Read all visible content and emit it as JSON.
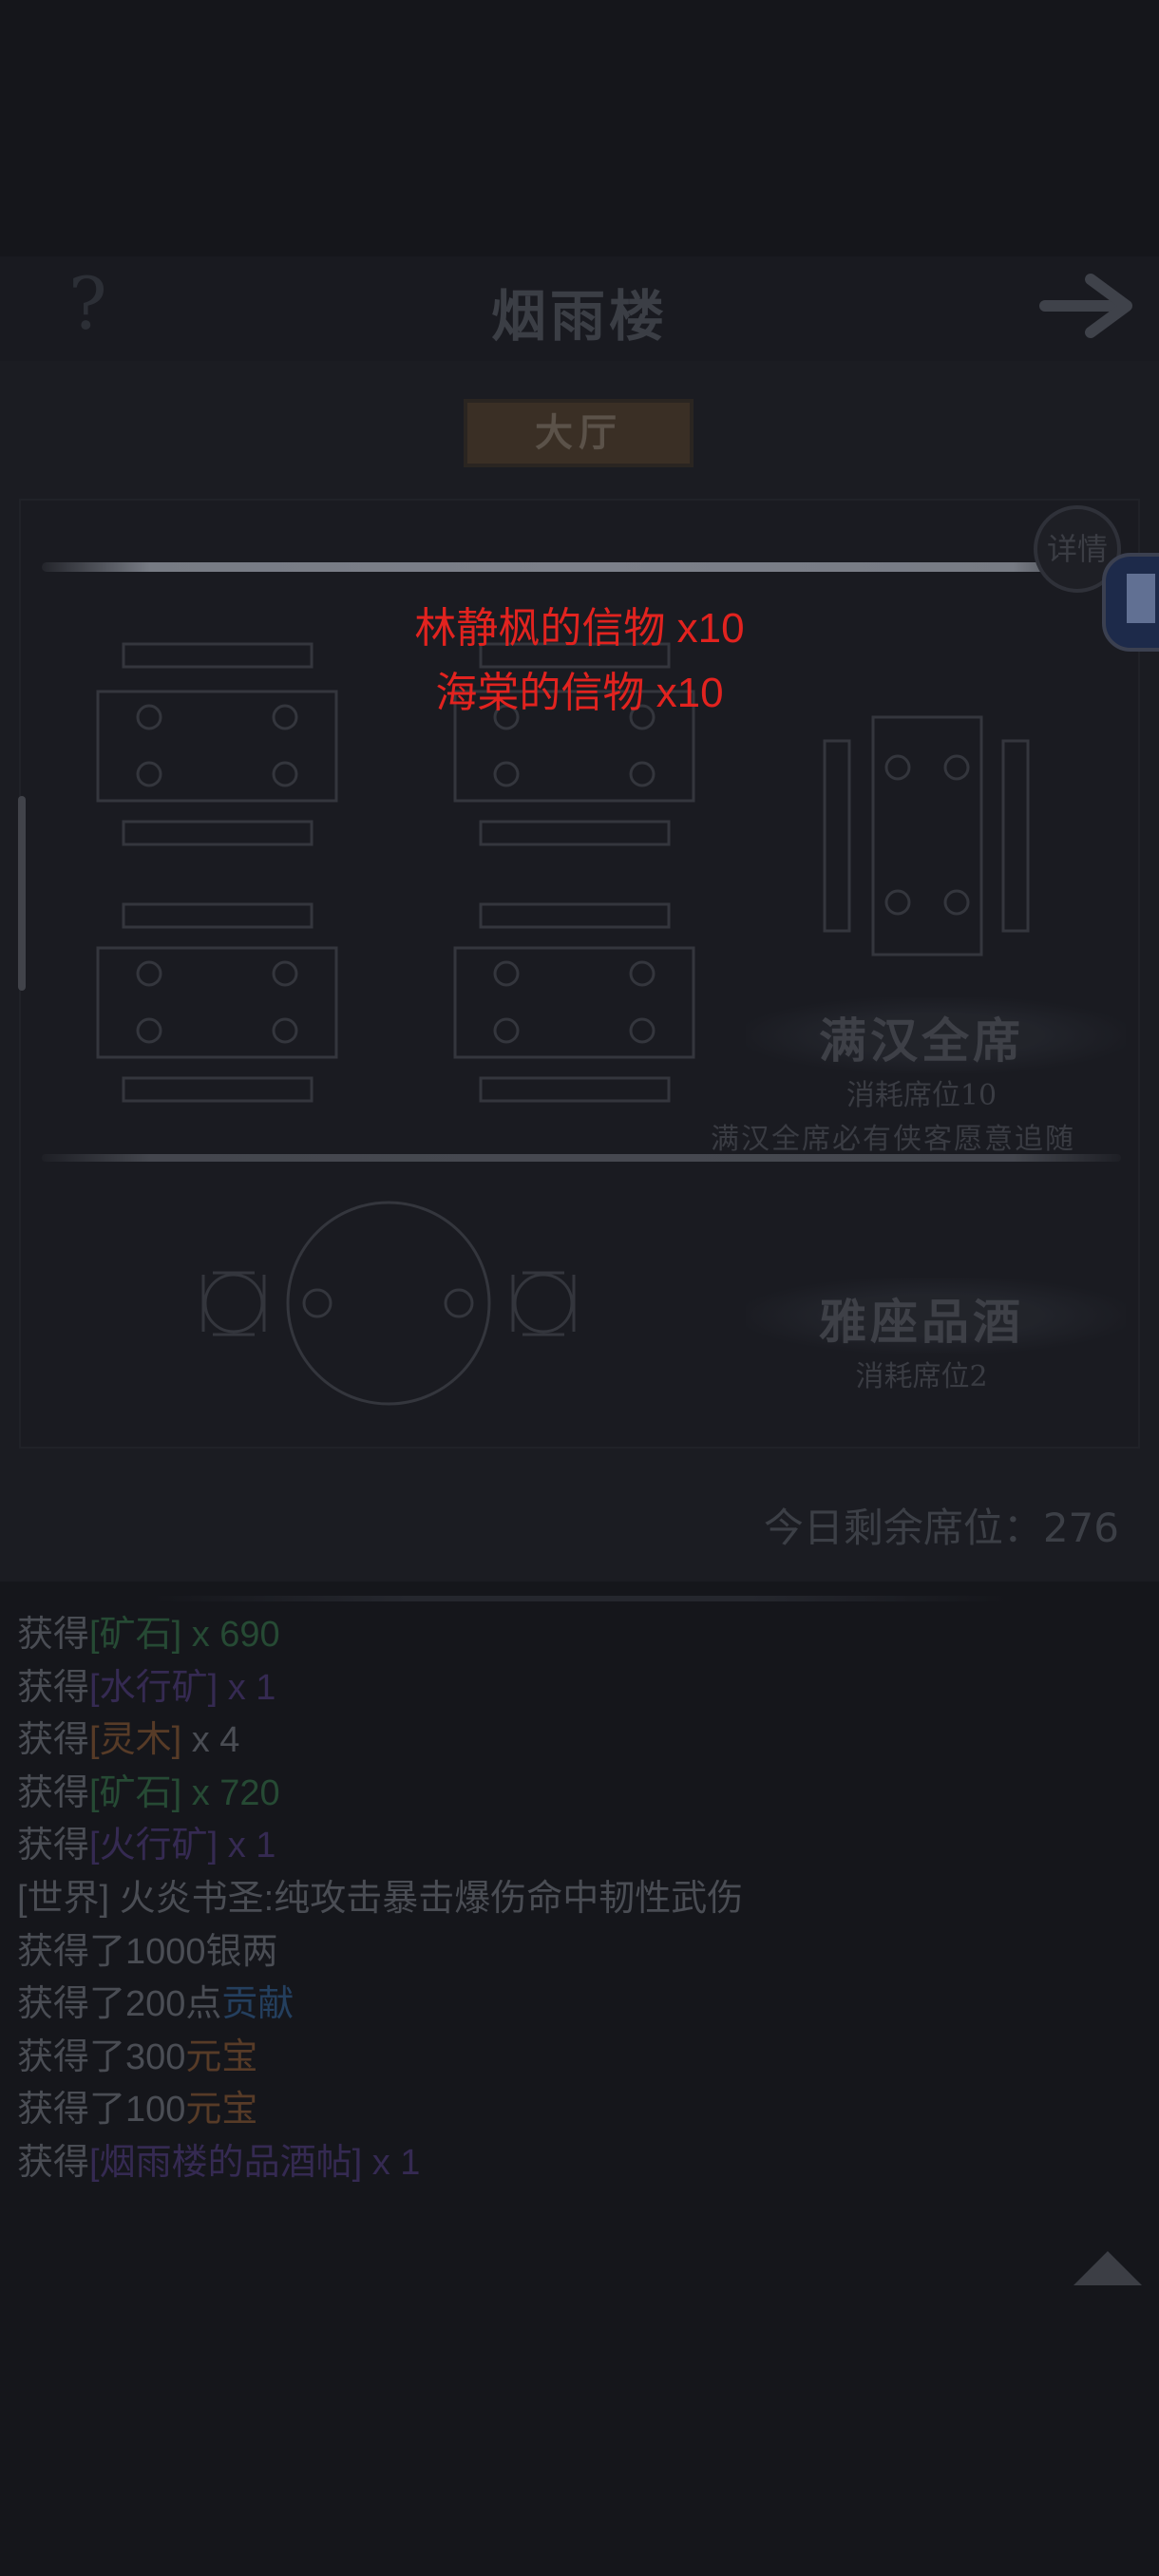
{
  "header": {
    "title": "烟雨楼",
    "help_glyph": "?",
    "arrow_icon": "arrow-right-icon"
  },
  "tab": {
    "label": "大厅"
  },
  "detail_button": {
    "label": "详情"
  },
  "sections": [
    {
      "title": "满汉全席",
      "cost": "消耗席位10",
      "note": "满汉全席必有侠客愿意追随"
    },
    {
      "title": "雅座品酒",
      "cost": "消耗席位2"
    }
  ],
  "popup": {
    "lines": [
      "林静枫的信物 x10",
      "海棠的信物 x10"
    ],
    "color": "#e2231f"
  },
  "remaining_seats": {
    "label": "今日剩余席位：276"
  },
  "log": {
    "line1": {
      "prefix": "获得",
      "item": "[矿石]",
      "suffix": " x 690"
    },
    "line2": {
      "prefix": "获得",
      "item": "[水行矿]",
      "suffix": " x 1"
    },
    "line3": {
      "prefix": "获得",
      "item": "[灵木]",
      "suffix": " x 4"
    },
    "line4": {
      "prefix": "获得",
      "item": "[矿石]",
      "suffix": " x 720"
    },
    "line5": {
      "prefix": "获得",
      "item": "[火行矿]",
      "suffix": " x 1"
    },
    "line6": {
      "text": "[世界] 火炎书圣:纯攻击暴击爆伤命中韧性武伤"
    },
    "line7": {
      "text": "获得了1000银两"
    },
    "line8": {
      "prefix": "获得了200点",
      "item": "贡献"
    },
    "line9": {
      "prefix": "获得了300",
      "item": "元宝"
    },
    "line10": {
      "prefix": "获得了100",
      "item": "元宝"
    },
    "line11": {
      "prefix": "获得",
      "item": "[烟雨楼的品酒帖]",
      "suffix": " x 1"
    }
  },
  "colors": {
    "background": "#15161b",
    "popup_text": "#e2231f",
    "rarity_green": "#264a34",
    "rarity_purple": "#352a52",
    "rarity_blue": "#243f5e",
    "rarity_orange": "#573b27"
  }
}
